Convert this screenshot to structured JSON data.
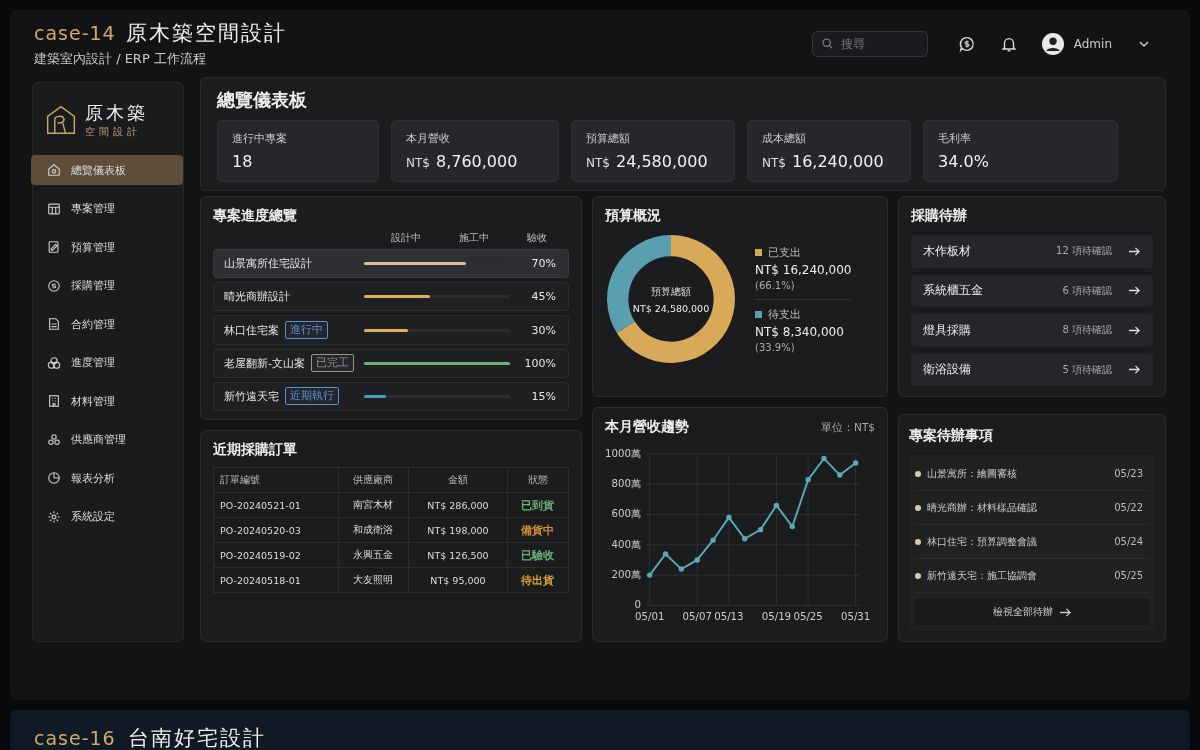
{
  "header": {
    "case": "case-14",
    "title": "原木築空間設計",
    "subtitle": "建築室內設計 / ERP 工作流程",
    "search": {
      "placeholder": "搜尋"
    },
    "user": "Admin"
  },
  "sidebar": {
    "logo": {
      "name": "原木築",
      "tagline": "空間設計"
    },
    "items": [
      {
        "label": "總覽儀表板",
        "selected": true
      },
      {
        "label": "專案管理",
        "selected": false
      },
      {
        "label": "預算管理",
        "selected": false
      },
      {
        "label": "採購管理",
        "selected": false
      },
      {
        "label": "合約管理",
        "selected": false
      },
      {
        "label": "進度管理",
        "selected": false
      },
      {
        "label": "材料管理",
        "selected": false
      },
      {
        "label": "供應商管理",
        "selected": false
      },
      {
        "label": "報表分析",
        "selected": false
      },
      {
        "label": "系統設定",
        "selected": false
      }
    ]
  },
  "overview": {
    "title": "總覽儀表板",
    "kpis": [
      {
        "label": "進行中專案",
        "value": "18"
      },
      {
        "label": "本月營收",
        "currency": "NT$",
        "value": "8,760,000"
      },
      {
        "label": "預算總額",
        "currency": "NT$",
        "value": "24,580,000"
      },
      {
        "label": "成本總額",
        "currency": "NT$",
        "value": "16,240,000"
      },
      {
        "label": "毛利率",
        "value": "34.0%"
      }
    ]
  },
  "progress": {
    "title": "專案進度總覽",
    "stages": [
      "設計中",
      "施工中",
      "驗收"
    ],
    "rows": [
      {
        "name": "山景寓所住宅設計",
        "level": 0.7,
        "percent": "70%",
        "color": "#dcc09a",
        "selected": true
      },
      {
        "name": "晴光商辦設計",
        "level": 0.45,
        "percent": "45%",
        "color": "#e2ae5c",
        "selected": false
      },
      {
        "name": "林口住宅案",
        "tag": {
          "text": "進行中",
          "color": "#5b8fd6"
        },
        "level": 0.3,
        "percent": "30%",
        "color": "#e2ae5c",
        "selected": false
      },
      {
        "name": "老屋翻新-文山案",
        "tag": {
          "text": "已完工",
          "color": "#9a9684"
        },
        "level": 1,
        "percent": "100%",
        "color": "#6fae7a",
        "selected": false
      },
      {
        "name": "新竹遠天宅",
        "tag": {
          "text": "近期執行",
          "color": "#5b8fd6"
        },
        "level": 0.15,
        "percent": "15%",
        "color": "#4a9cc0",
        "selected": false
      }
    ]
  },
  "orders": {
    "title": "近期採購訂單",
    "columns": [
      "訂單編號",
      "供應廠商",
      "金額",
      "狀態"
    ],
    "rows": [
      {
        "id": "PO-20240521-01",
        "vendor": "南宮木材",
        "amount": "NT$ 286,000",
        "status": "已到貨",
        "color": "#6fae7a"
      },
      {
        "id": "PO-20240520-03",
        "vendor": "和成衛浴",
        "amount": "NT$ 198,000",
        "status": "備貨中",
        "color": "#d98f3a"
      },
      {
        "id": "PO-20240519-02",
        "vendor": "永興五金",
        "amount": "NT$ 126,500",
        "status": "已驗收",
        "color": "#6fae7a"
      },
      {
        "id": "PO-20240518-01",
        "vendor": "大友照明",
        "amount": "NT$ 95,000",
        "status": "待出貨",
        "color": "#d9a03a"
      }
    ]
  },
  "budget": {
    "title": "預算概況",
    "center_label": "預算總額",
    "center_value": "NT$ 24,580,000",
    "legend": [
      {
        "amount": "NT$ 16,240,000",
        "share": "(66.1%)",
        "color": "#d9a95a"
      },
      {
        "amount": "NT$ 8,340,000",
        "share": "(33.9%)",
        "color": "#5a9fb0"
      }
    ],
    "chart_data": {
      "type": "donut",
      "categories": [
        "已支出",
        "待支出"
      ],
      "values": [
        66.1,
        33.9
      ]
    }
  },
  "trend": {
    "title": "本月營收趨勢",
    "unit": "單位：NT$",
    "chart_data": {
      "type": "line",
      "categories": [
        "05/01",
        null,
        null,
        "05/07",
        null,
        "05/13",
        null,
        null,
        "05/19",
        null,
        "05/25",
        null,
        null,
        "05/31"
      ],
      "series": [
        {
          "color": "#5aa9b8",
          "values": [
            200,
            340,
            240,
            300,
            430,
            580,
            440,
            500,
            660,
            520,
            830,
            970,
            860,
            940
          ]
        }
      ],
      "ylim": [
        0,
        1000
      ],
      "grid": true,
      "yticks": [
        {
          "value": 0,
          "label": "0"
        },
        {
          "value": 200,
          "label": "200萬"
        },
        {
          "value": 400,
          "label": "400萬"
        },
        {
          "value": 600,
          "label": "600萬"
        },
        {
          "value": 800,
          "label": "800萬"
        },
        {
          "value": 1000,
          "label": "1000萬"
        }
      ]
    }
  },
  "pending_purchases": {
    "title": "採購待辦",
    "items": [
      {
        "name": "木作板材",
        "count": "12 項待確認"
      },
      {
        "name": "系統櫃五金",
        "count": "6 項待確認"
      },
      {
        "name": "燈具採購",
        "count": "8 項待確認"
      },
      {
        "name": "衛浴設備",
        "count": "5 項待確認"
      }
    ]
  },
  "todos": {
    "title": "專案待辦事項",
    "items": [
      {
        "text": "山景寓所：繪圖審核",
        "date": "05/23"
      },
      {
        "text": "晴光商辦：材料樣品確認",
        "date": "05/22"
      },
      {
        "text": "林口住宅：預算調整會議",
        "date": "05/24"
      },
      {
        "text": "新竹遠天宅：施工協調會",
        "date": "05/25"
      }
    ],
    "button": "檢視全部待辦"
  },
  "next_case": {
    "case": "case-16",
    "title": "台南好宅設計"
  }
}
